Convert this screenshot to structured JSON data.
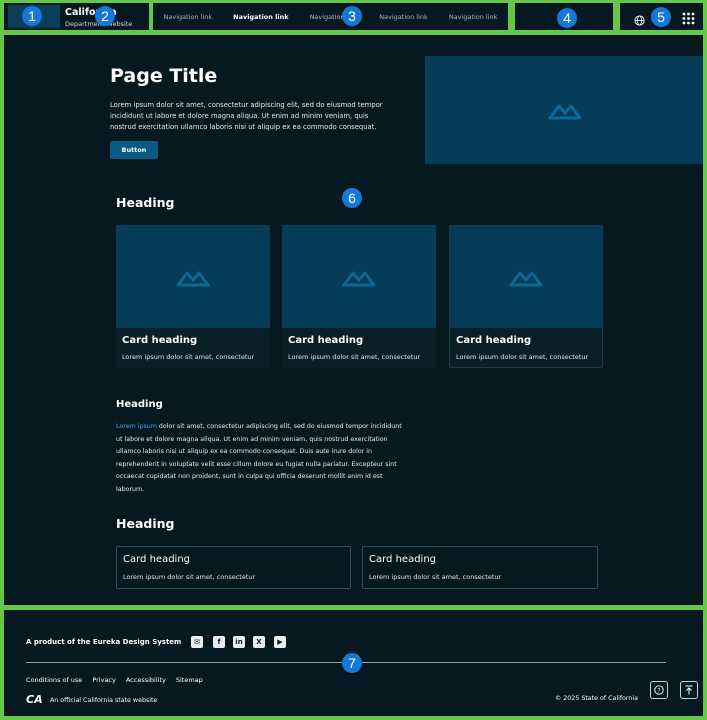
{
  "badges": [
    "1",
    "2",
    "3",
    "4",
    "5",
    "6",
    "7"
  ],
  "header": {
    "agency_name": "California",
    "agency_sub": "Department Website",
    "nav": [
      "Navigation link",
      "Navigation link",
      "Navigation link",
      "Navigation link",
      "Navigation link"
    ],
    "nav_active_index": 1
  },
  "hero": {
    "title": "Page Title",
    "body": "Lorem ipsum dolor sit amet, consectetur adipiscing elit, sed do eiusmod tempor incididunt ut labore et dolore magna aliqua. Ut enim ad minim veniam, quis nostrud exercitation ullamco laboris nisi ut aliquip ex ea commodo consequat.",
    "button": "Button"
  },
  "section1": {
    "heading": "Heading",
    "cards": [
      {
        "title": "Card heading",
        "text": "Lorem ipsum dolor sit amet, consectetur"
      },
      {
        "title": "Card heading",
        "text": "Lorem ipsum dolor sit amet, consectetur"
      },
      {
        "title": "Card heading",
        "text": "Lorem ipsum dolor sit amet, consectetur"
      }
    ]
  },
  "section2": {
    "heading": "Heading",
    "link": "Lorem ipsum",
    "body": " dolor sit amet, consectetur adipiscing elit, sed do eiusmod tempor incididunt ut labore et dolore magna aliqua. Ut enim ad minim veniam, quis nostrud exercitation ullamco laboris nisi ut aliquip ex ea commodo consequat. Duis aute irure dolor in reprehenderit in voluptate velit esse cillum dolore eu fugiat nulla pariatur. Excepteur sint occaecat cupidatat non proident, sunt in culpa qui officia deserunt mollit anim id est laborum."
  },
  "section3": {
    "heading": "Heading",
    "cards": [
      {
        "title": "Card heading",
        "text": "Lorem ipsum dolor sit amet, consectetur"
      },
      {
        "title": "Card heading",
        "text": "Lorem ipsum dolor sit amet, consectetur"
      }
    ]
  },
  "footer": {
    "product": "A product of the Eureka Design System",
    "links": [
      "Conditions of use",
      "Privacy",
      "Accessibility",
      "Sitemap"
    ],
    "official": "An official California state website",
    "copyright": "© 2025 State of California",
    "ca_logo": "CA"
  },
  "colors": {
    "accent": "#66c64a",
    "badge": "#1677d6",
    "button": "#0a5a82",
    "placeholder": "#053c57"
  }
}
